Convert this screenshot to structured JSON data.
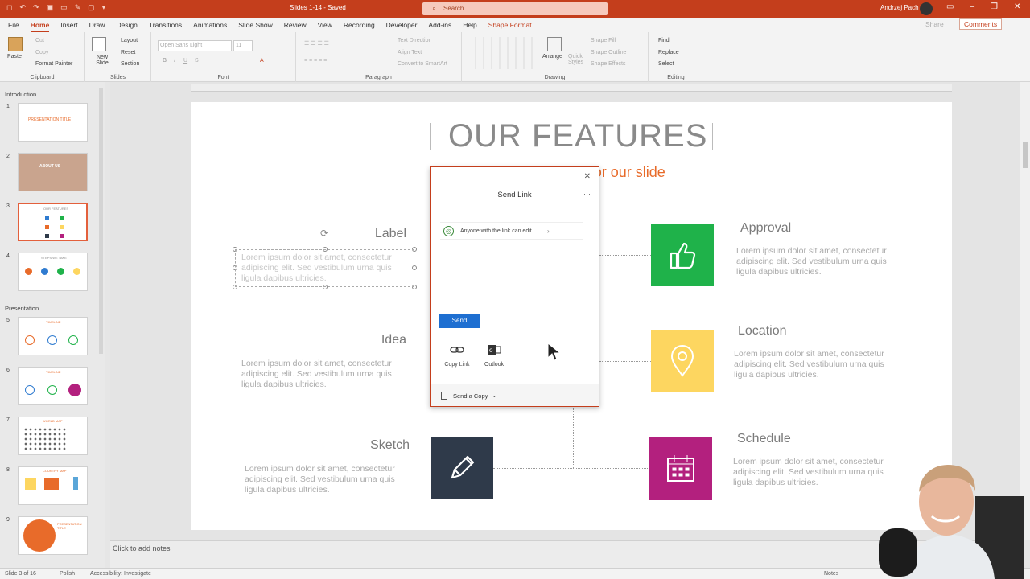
{
  "titlebar": {
    "doc_title": "Slides 1-14  -  Saved",
    "search_placeholder": "Search",
    "user_name": "Andrzej Pach"
  },
  "menu": {
    "tabs": [
      "File",
      "Home",
      "Insert",
      "Draw",
      "Design",
      "Transitions",
      "Animations",
      "Slide Show",
      "Review",
      "View",
      "Recording",
      "Developer",
      "Add-ins",
      "Help",
      "Shape Format"
    ],
    "share": "Share",
    "comments": "Comments"
  },
  "ribbon": {
    "clipboard": {
      "paste": "Paste",
      "cut": "Cut",
      "copy": "Copy",
      "format_painter": "Format Painter",
      "label": "Clipboard"
    },
    "slides": {
      "new_slide": "New Slide",
      "layout": "Layout",
      "reset": "Reset",
      "section": "Section",
      "label": "Slides"
    },
    "font": {
      "family": "Open Sans Light",
      "size": "11",
      "label": "Font"
    },
    "paragraph": {
      "text_direction": "Text Direction",
      "align_text": "Align Text",
      "convert_smartart": "Convert to SmartArt",
      "label": "Paragraph"
    },
    "drawing": {
      "arrange": "Arrange",
      "quick_styles": "Quick Styles",
      "shape_fill": "Shape Fill",
      "shape_outline": "Shape Outline",
      "shape_effects": "Shape Effects",
      "label": "Drawing"
    },
    "editing": {
      "find": "Find",
      "replace": "Replace",
      "select": "Select",
      "label": "Editing"
    }
  },
  "sidebar": {
    "sections": [
      "Introduction",
      "Presentation"
    ],
    "slides": [
      {
        "num": "1",
        "text": "PRESENTATION TITLE"
      },
      {
        "num": "2",
        "text": "ABOUT US"
      },
      {
        "num": "3",
        "text": "OUR FEATURES"
      },
      {
        "num": "4",
        "text": "STEPS WE TAKE"
      },
      {
        "num": "5",
        "text": "TIMELINE"
      },
      {
        "num": "6",
        "text": "TIMELINE"
      },
      {
        "num": "7",
        "text": "WORLD MAP"
      },
      {
        "num": "8",
        "text": "COUNTRY MAP"
      },
      {
        "num": "9",
        "text": "PRESENTATION TITLE"
      }
    ]
  },
  "slide": {
    "title": "OUR FEATURES",
    "subtitle": "This will be the Tagline for our slide",
    "lorem": "Lorem ipsum dolor sit amet, consectetur adipiscing elit. Sed vestibulum urna quis ligula dapibus ultricies.",
    "left_labels": [
      "Label",
      "Idea",
      "Sketch"
    ],
    "right_labels": [
      "Approval",
      "Location",
      "Schedule"
    ],
    "colors": {
      "green": "#1fb24a",
      "yellow": "#fdd660",
      "navy": "#2f3a4a",
      "magenta": "#b3207e",
      "orange": "#e86b2a"
    }
  },
  "dialog": {
    "title": "Send Link",
    "permission": "Anyone with the link can edit",
    "send": "Send",
    "copy_link": "Copy Link",
    "outlook": "Outlook",
    "send_copy": "Send a Copy"
  },
  "notes": {
    "placeholder": "Click to add notes"
  },
  "status": {
    "slide_info": "Slide 3 of 16",
    "language": "Polish",
    "accessibility": "Accessibility: Investigate",
    "notes": "Notes"
  }
}
